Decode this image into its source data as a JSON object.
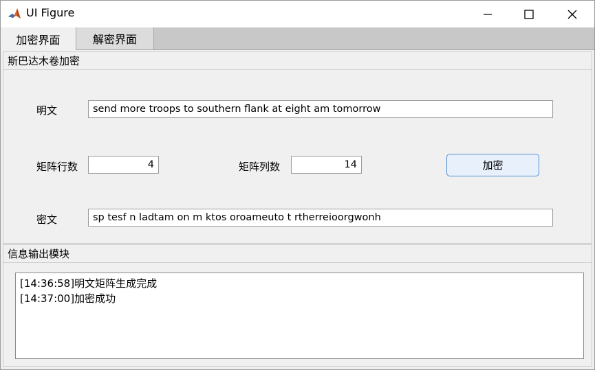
{
  "window": {
    "title": "UI Figure",
    "minimize_icon": "minimize-icon",
    "maximize_icon": "maximize-icon",
    "close_icon": "close-icon"
  },
  "tabs": [
    {
      "label": "加密界面",
      "active": true
    },
    {
      "label": "解密界面",
      "active": false
    }
  ],
  "encrypt_panel": {
    "title": "斯巴达木卷加密",
    "plaintext_label": "明文",
    "plaintext_value": "send more troops to southern flank at eight am tomorrow",
    "rows_label": "矩阵行数",
    "rows_value": "4",
    "cols_label": "矩阵列数",
    "cols_value": "14",
    "encrypt_button": "加密",
    "ciphertext_label": "密文",
    "ciphertext_value": "sp tesf n ladtam on m ktos oroameuto t rtherreioorgwonh"
  },
  "info_panel": {
    "title": "信息输出模块",
    "log": [
      "[14:36:58]明文矩阵生成完成",
      "[14:37:00]加密成功"
    ]
  },
  "colors": {
    "accent_border": "#4f8fd6",
    "button_bg": "#e8f0fb",
    "panel_bg": "#f0f0f0",
    "tab_strip_bg": "#c8c8c8"
  }
}
